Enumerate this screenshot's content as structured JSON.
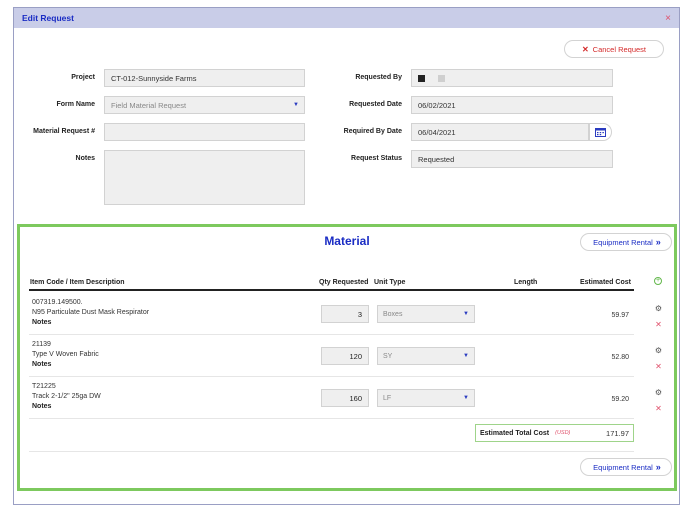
{
  "modal": {
    "title": "Edit Request",
    "close_label": "×"
  },
  "cancel_button": {
    "label": "Cancel Request"
  },
  "form": {
    "project": {
      "label": "Project",
      "value": "CT-012-Sunnyside Farms"
    },
    "form_name": {
      "label": "Form Name",
      "value": "Field Material Request"
    },
    "material_request_no": {
      "label": "Material Request #",
      "value": ""
    },
    "notes": {
      "label": "Notes",
      "value": ""
    },
    "requested_by": {
      "label": "Requested By",
      "value": ""
    },
    "requested_date": {
      "label": "Requested Date",
      "value": "06/02/2021"
    },
    "required_by_date": {
      "label": "Required By Date",
      "value": "06/04/2021"
    },
    "request_status": {
      "label": "Request Status",
      "value": "Requested"
    }
  },
  "material": {
    "title": "Material",
    "equipment_rental_label": "Equipment Rental",
    "headers": {
      "item": "Item Code / Item Description",
      "qty": "Qty Requested",
      "unit": "Unit Type",
      "length": "Length",
      "cost": "Estimated Cost"
    },
    "items": [
      {
        "code": "007319.149500.",
        "description": "N95 Particulate Dust Mask Respirator",
        "notes": "Notes",
        "qty": "3",
        "unit": "Boxes",
        "cost": "59.97"
      },
      {
        "code": "21139",
        "description": "Type V Woven Fabric",
        "notes": "Notes",
        "qty": "120",
        "unit": "SY",
        "cost": "52.80"
      },
      {
        "code": "T21225",
        "description": "Track 2-1/2\" 25ga DW",
        "notes": "Notes",
        "qty": "160",
        "unit": "LF",
        "cost": "59.20"
      }
    ],
    "total": {
      "label": "Estimated Total Cost",
      "currency": "(USD)",
      "value": "171.97"
    }
  },
  "colors": {
    "accent": "#1a2cc4",
    "danger": "#d42a2a",
    "success_border": "#7dc95e"
  },
  "icons": [
    "close-icon",
    "calendar-icon",
    "chevron-down-icon",
    "gear-icon",
    "delete-icon",
    "add-icon",
    "double-chevron-right-icon"
  ]
}
